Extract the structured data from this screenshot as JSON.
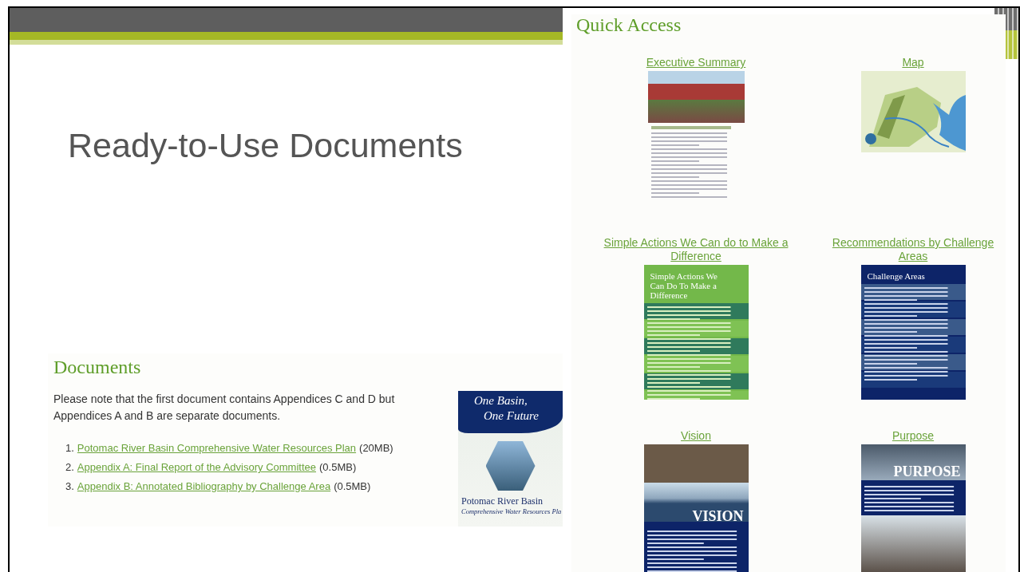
{
  "slide": {
    "title": "Ready-to-Use Documents"
  },
  "documents_panel": {
    "heading": "Documents",
    "note": "Please note that the first document contains Appendices C and D but Appendices A and B are separate documents.",
    "items": [
      {
        "number": "1.",
        "link": "Potomac River Basin Comprehensive Water Resources Plan",
        "size": "(20MB)"
      },
      {
        "number": "2.",
        "link": "Appendix A: Final Report of the Advisory Committee",
        "size": "(0.5MB)"
      },
      {
        "number": "3.",
        "link": "Appendix B: Annotated Bibliography by Challenge Area",
        "size": "(0.5MB)"
      }
    ],
    "cover": {
      "lines": [
        "One Basin,",
        "One Future"
      ],
      "title": "Potomac River Basin",
      "subtitle": "Comprehensive Water Resources Pla"
    }
  },
  "quick_access": {
    "heading": "Quick Access",
    "tiles": [
      {
        "label": "Executive Summary",
        "kind": "report"
      },
      {
        "label": "Map",
        "kind": "map"
      },
      {
        "label": "Simple Actions We Can do to Make a Difference",
        "kind": "green-poster",
        "poster_title": "Simple Actions We Can Do To Make a Difference"
      },
      {
        "label": "Recommendations by Challenge Areas",
        "kind": "blue-poster",
        "poster_title": "Challenge Areas"
      },
      {
        "label": "Vision",
        "kind": "vision-cover",
        "poster_title": "VISION"
      },
      {
        "label": "Purpose",
        "kind": "purpose-cover",
        "poster_title": "PURPOSE"
      }
    ]
  }
}
